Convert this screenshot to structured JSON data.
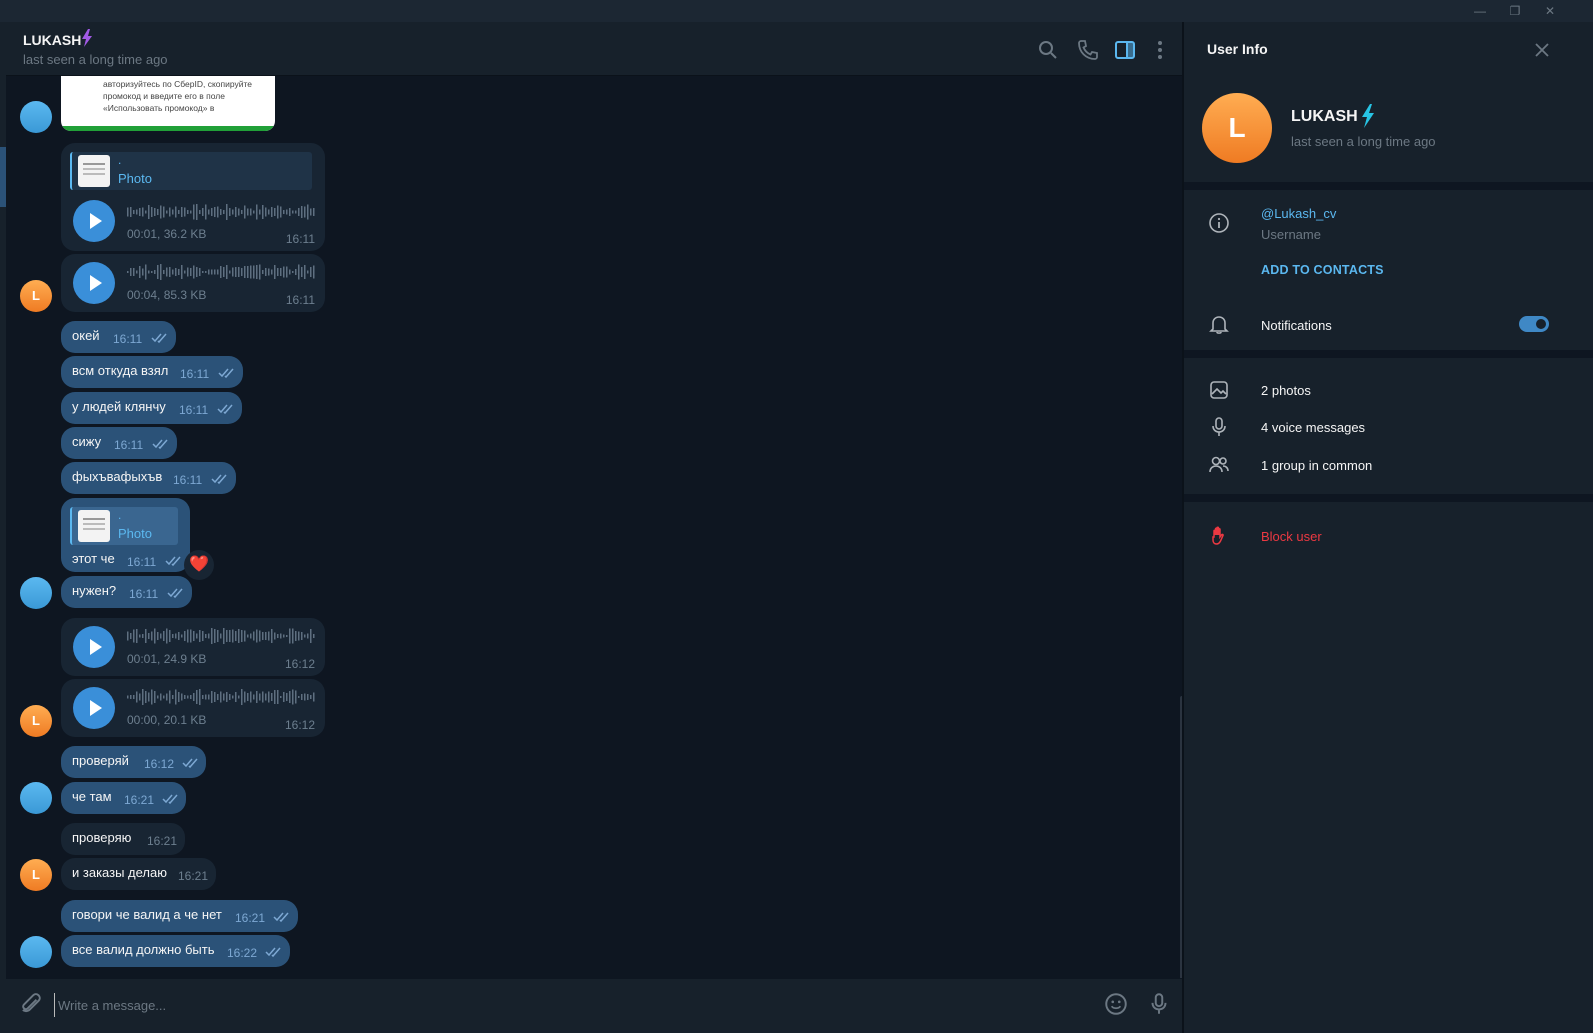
{
  "chat": {
    "name": "LUKASH",
    "status": "last seen a long time ago"
  },
  "image_preview_text": "авторизуйтесь по СберID, скопируйте промокод и введите его в поле «Использовать промокод» в",
  "messages": [
    {
      "kind": "voice",
      "reply": {
        "dot": ".",
        "label": "Photo"
      },
      "meta": "00:01, 36.2 KB",
      "time": "16:11"
    },
    {
      "kind": "voice",
      "meta": "00:04, 85.3 KB",
      "time": "16:11"
    },
    {
      "kind": "text",
      "text": "окей",
      "time": "16:11"
    },
    {
      "kind": "text",
      "text": "всм откуда взял",
      "time": "16:11"
    },
    {
      "kind": "text",
      "text": "у людей клянчу",
      "time": "16:11"
    },
    {
      "kind": "text",
      "text": "сижу",
      "time": "16:11"
    },
    {
      "kind": "text",
      "text": "фыхъвафыхъв",
      "time": "16:11"
    },
    {
      "kind": "text",
      "reply": {
        "dot": ".",
        "label": "Photo"
      },
      "text": "этот че",
      "time": "16:11",
      "reaction": "❤️"
    },
    {
      "kind": "text",
      "text": "нужен?",
      "time": "16:11"
    },
    {
      "kind": "voice",
      "meta": "00:01, 24.9 KB",
      "time": "16:12"
    },
    {
      "kind": "voice",
      "meta": "00:00, 20.1 KB",
      "time": "16:12"
    },
    {
      "kind": "text",
      "text": "проверяй",
      "time": "16:12"
    },
    {
      "kind": "text",
      "text": "че там",
      "time": "16:21"
    },
    {
      "kind": "text",
      "text": "проверяю",
      "time": "16:21"
    },
    {
      "kind": "text",
      "text": "и заказы делаю",
      "time": "16:21"
    },
    {
      "kind": "text",
      "text": "говори че валид а че нет",
      "time": "16:21"
    },
    {
      "kind": "text",
      "text": "все валид должно быть",
      "time": "16:22"
    }
  ],
  "composer": {
    "placeholder": "Write a message..."
  },
  "panel": {
    "title": "User Info",
    "avatar_letter": "L",
    "name": "LUKASH",
    "status": "last seen a long time ago",
    "username": "@Lukash_cv",
    "username_label": "Username",
    "add_contacts": "ADD TO CONTACTS",
    "notifications": "Notifications",
    "notifications_on": true,
    "photos": "2 photos",
    "voice": "4 voice messages",
    "groups": "1 group in common",
    "block": "Block user"
  },
  "avatar_letter": "L",
  "colors": {
    "bg": "#0e1621",
    "panel": "#17212b",
    "outgoing": "#2b5278",
    "incoming": "#182533",
    "accent": "#5bb8f0",
    "danger": "#ec3942",
    "bolt": "#27c4e4"
  }
}
